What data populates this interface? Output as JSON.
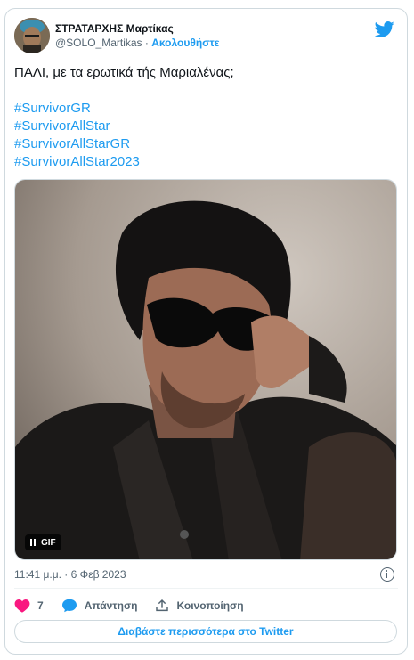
{
  "author": {
    "display_name": "ΣΤΡΑΤΑΡΧΗΣ Μαρτίκας",
    "handle": "@SOLO_Martikas",
    "separator": " · ",
    "follow_label": "Ακολουθήστε"
  },
  "tweet": {
    "text": "ΠΑΛΙ, με τα ερωτικά τής Μαριαλένας;",
    "hashtags": [
      "#SurvivorGR",
      "#SurvivorAllStar",
      "#SurvivorAllStarGR",
      "#SurvivorAllStar2023"
    ]
  },
  "media": {
    "badge_label": "GIF",
    "description_icon": "pause-icon"
  },
  "meta": {
    "timestamp": "11:41 μ.μ. · 6 Φεβ 2023"
  },
  "actions": {
    "like_count": "7",
    "reply_label": "Απάντηση",
    "share_label": "Κοινοποίηση"
  },
  "read_more_label": "Διαβάστε περισσότερα στο Twitter",
  "colors": {
    "accent": "#1d9bf0",
    "like": "#f91880",
    "text": "#0f1419",
    "muted": "#536471"
  }
}
